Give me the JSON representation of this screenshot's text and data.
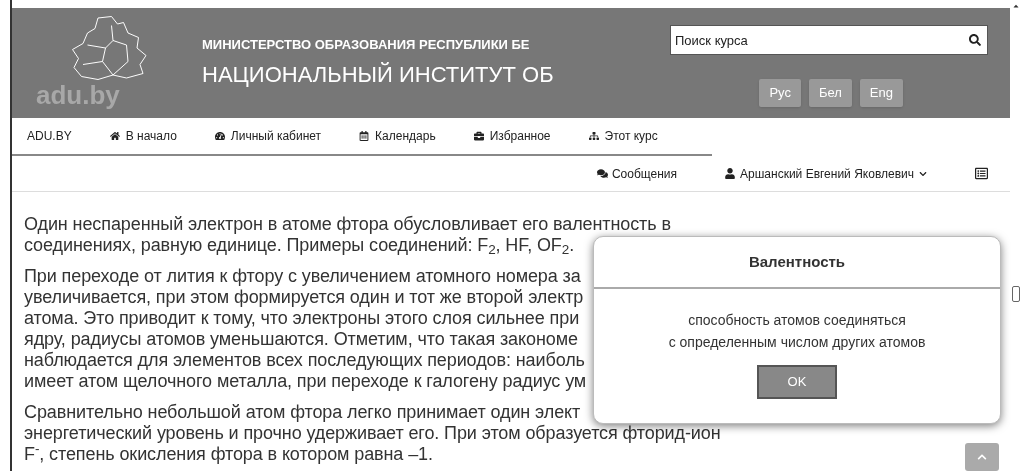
{
  "header": {
    "logo_text": "adu.by",
    "ministry": "МИНИСТЕРСТВО ОБРАЗОВАНИЯ РЕСПУБЛИКИ БЕ",
    "institute": "НАЦИОНАЛЬНЫЙ ИНСТИТУТ ОБ",
    "search": {
      "placeholder": "Поиск курса"
    },
    "languages": [
      {
        "label": "Рус"
      },
      {
        "label": "Бел"
      },
      {
        "label": "Eng"
      }
    ]
  },
  "nav": {
    "brand": "ADU.BY",
    "items": [
      {
        "label": "В начало"
      },
      {
        "label": "Личный кабинет"
      },
      {
        "label": "Календарь"
      },
      {
        "label": "Избранное"
      },
      {
        "label": "Этот курс"
      }
    ]
  },
  "user_bar": {
    "messages": "Сообщения",
    "user": "Аршанский Евгений Яковлевич"
  },
  "article": {
    "paragraphs": [
      [
        "Один неспаренный электрон в атоме фтора обусловливает его валентность в",
        "соединениях, равную единице. Примеры соединений: F$_{2}$, HF, OF$_{2}$."
      ],
      [
        "При переходе от лития к фтору с увеличением атомного номера за",
        "увеличивается, при этом формируется один и тот же второй электр",
        "атома. Это приводит к тому, что электроны этого слоя сильнее при",
        "ядру, радиусы атомов уменьшаются. Отметим, что такая закономе",
        "наблюдается для элементов всех последующих периодов: наиболь",
        "имеет атом щелочного металла, при переходе к галогену радиус ум"
      ],
      [
        "Сравнительно небольшой атом фтора легко принимает один элект",
        "энергетический уровень и прочно удерживает его. При этом образуется фторид-ион",
        "F$^{-}$, степень окисления фтора в котором равна –1."
      ]
    ]
  },
  "dialog": {
    "title": "Валентность",
    "lines": [
      "способность атомов соединяться",
      "с определенным числом других атомов"
    ],
    "button": "OK"
  }
}
